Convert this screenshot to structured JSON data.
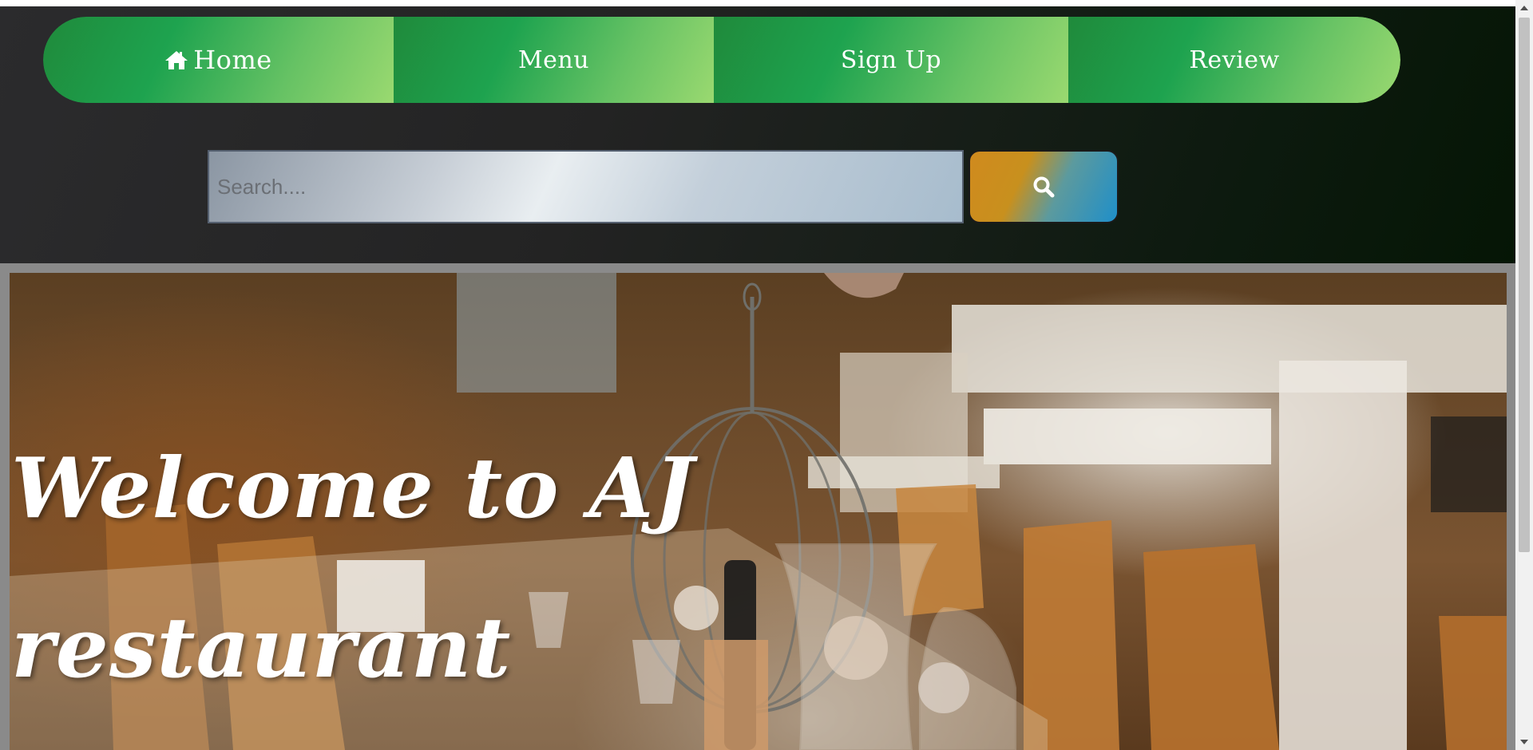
{
  "nav": {
    "items": [
      {
        "label": "Home",
        "icon": "home-icon"
      },
      {
        "label": "Menu"
      },
      {
        "label": "Sign Up"
      },
      {
        "label": "Review"
      }
    ]
  },
  "search": {
    "placeholder": "Search....",
    "value": "",
    "button_icon": "search-icon"
  },
  "hero": {
    "title": "Welcome to AJ restaurant"
  },
  "colors": {
    "nav_green": "#1ea34f",
    "nav_light_green": "#9ad970",
    "search_button_orange": "#d08a1e",
    "search_button_blue": "#1f8fc9",
    "header_dark": "#232323"
  }
}
